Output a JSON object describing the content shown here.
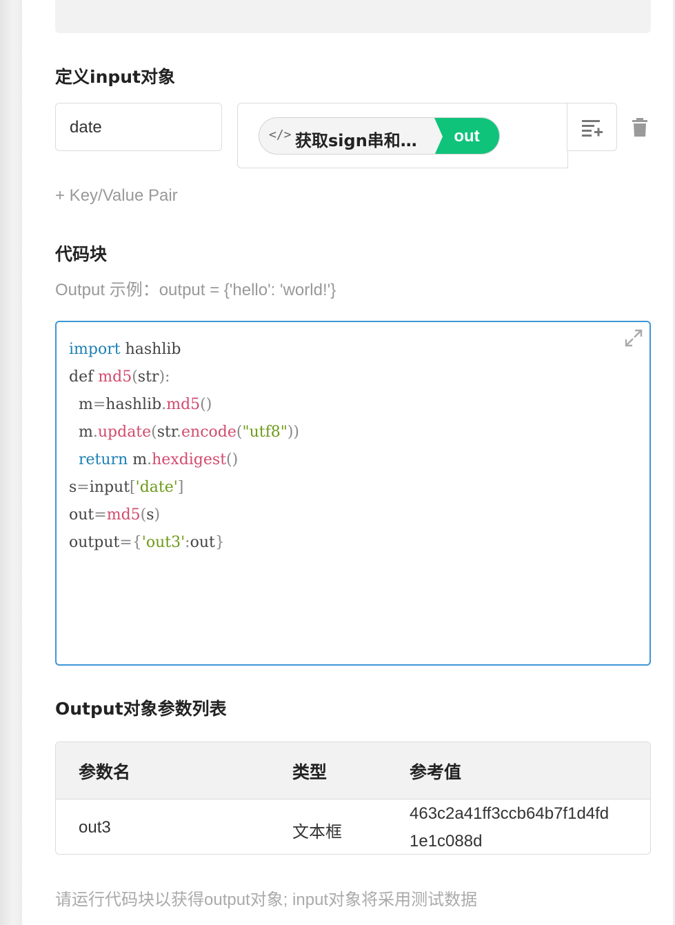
{
  "sections": {
    "input_title": "定义input对象",
    "code_title": "代码块",
    "output_title": "Output对象参数列表"
  },
  "input_pairs": [
    {
      "key": "date",
      "value_pill": {
        "label": "获取sign串和…",
        "tag": "out"
      }
    }
  ],
  "add_pair_label": "+ Key/Value Pair",
  "code_hint": "Output 示例：output = {'hello': 'world!'}",
  "code_lines": [
    "import hashlib",
    "def md5(str):",
    "  m=hashlib.md5()",
    "  m.update(str.encode(\"utf8\"))",
    "  return m.hexdigest()",
    "s=input['date']",
    "out=md5(s)",
    "output={'out3':out}"
  ],
  "output_table": {
    "headers": [
      "参数名",
      "类型",
      "参考值"
    ],
    "rows": [
      {
        "name": "out3",
        "type": "文本框",
        "value_line1": "463c2a41ff3ccb64b7f1d4fd",
        "value_line2": "1e1c088d"
      }
    ]
  },
  "footer_note": "请运行代码块以获得output对象; input对象将采用测试数据",
  "colors": {
    "accent": "#0fc37a",
    "focus_border": "#3d96d6",
    "keyword": "#1d80b6",
    "function": "#d14b6d",
    "string": "#6c9a16"
  },
  "icons": [
    "code-icon",
    "list-add-icon",
    "trash-icon",
    "expand-icon"
  ]
}
